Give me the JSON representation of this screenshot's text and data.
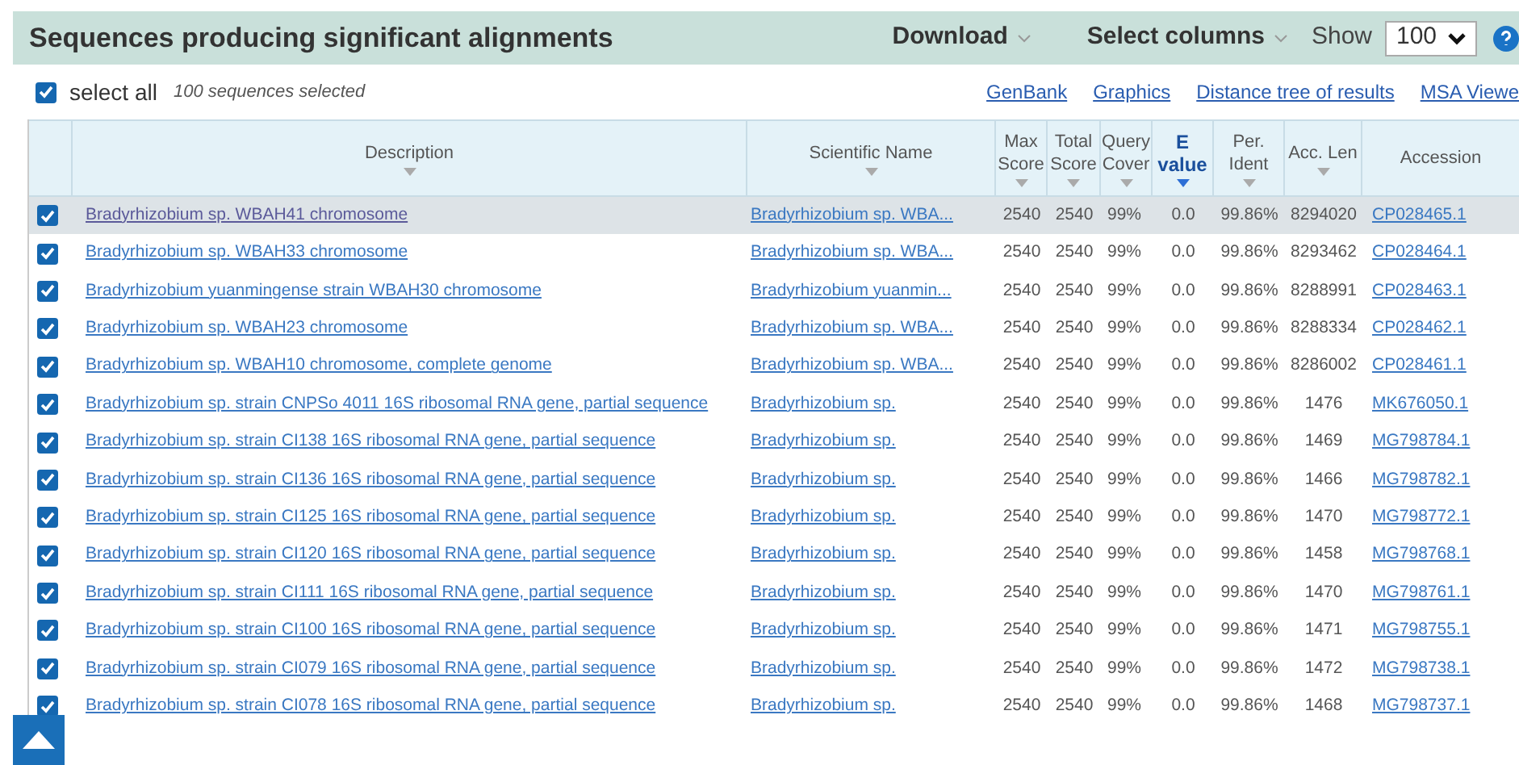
{
  "header": {
    "title": "Sequences producing significant alignments",
    "download": "Download",
    "select_columns": "Select columns",
    "show_label": "Show",
    "show_value": "100"
  },
  "toolbar": {
    "select_all": {
      "label": "select all",
      "checked": true
    },
    "selected_count": "100 sequences selected",
    "links": [
      "GenBank",
      "Graphics",
      "Distance tree of results",
      "MSA Viewe"
    ]
  },
  "table": {
    "columns": [
      {
        "label": "Description",
        "sorted": false
      },
      {
        "label": "Scientific Name",
        "sorted": false
      },
      {
        "label": "Max Score",
        "sorted": false
      },
      {
        "label": "Total Score",
        "sorted": false
      },
      {
        "label": "Query Cover",
        "sorted": false
      },
      {
        "label": "E value",
        "sorted": true
      },
      {
        "label": "Per. Ident",
        "sorted": false
      },
      {
        "label": "Acc. Len",
        "sorted": false
      },
      {
        "label": "Accession",
        "sortable": false
      }
    ],
    "rows": [
      {
        "checked": true,
        "selected": true,
        "cells": [
          "Bradyrhizobium sp. WBAH41 chromosome",
          "Bradyrhizobium sp. WBA...",
          "2540",
          "2540",
          "99%",
          "0.0",
          "99.86%",
          "8294020",
          "CP028465.1"
        ]
      },
      {
        "checked": true,
        "selected": false,
        "cells": [
          "Bradyrhizobium sp. WBAH33 chromosome",
          "Bradyrhizobium sp. WBA...",
          "2540",
          "2540",
          "99%",
          "0.0",
          "99.86%",
          "8293462",
          "CP028464.1"
        ]
      },
      {
        "checked": true,
        "selected": false,
        "cells": [
          "Bradyrhizobium yuanmingense strain WBAH30 chromosome",
          "Bradyrhizobium yuanmin...",
          "2540",
          "2540",
          "99%",
          "0.0",
          "99.86%",
          "8288991",
          "CP028463.1"
        ]
      },
      {
        "checked": true,
        "selected": false,
        "cells": [
          "Bradyrhizobium sp. WBAH23 chromosome",
          "Bradyrhizobium sp. WBA...",
          "2540",
          "2540",
          "99%",
          "0.0",
          "99.86%",
          "8288334",
          "CP028462.1"
        ]
      },
      {
        "checked": true,
        "selected": false,
        "cells": [
          "Bradyrhizobium sp. WBAH10 chromosome, complete genome",
          "Bradyrhizobium sp. WBA...",
          "2540",
          "2540",
          "99%",
          "0.0",
          "99.86%",
          "8286002",
          "CP028461.1"
        ]
      },
      {
        "checked": true,
        "selected": false,
        "cells": [
          "Bradyrhizobium sp. strain CNPSo 4011 16S ribosomal RNA gene, partial sequence",
          "Bradyrhizobium sp.",
          "2540",
          "2540",
          "99%",
          "0.0",
          "99.86%",
          "1476",
          "MK676050.1"
        ]
      },
      {
        "checked": true,
        "selected": false,
        "cells": [
          "Bradyrhizobium sp. strain CI138 16S ribosomal RNA gene, partial sequence",
          "Bradyrhizobium sp.",
          "2540",
          "2540",
          "99%",
          "0.0",
          "99.86%",
          "1469",
          "MG798784.1"
        ]
      },
      {
        "checked": true,
        "selected": false,
        "cells": [
          "Bradyrhizobium sp. strain CI136 16S ribosomal RNA gene, partial sequence",
          "Bradyrhizobium sp.",
          "2540",
          "2540",
          "99%",
          "0.0",
          "99.86%",
          "1466",
          "MG798782.1"
        ]
      },
      {
        "checked": true,
        "selected": false,
        "cells": [
          "Bradyrhizobium sp. strain CI125 16S ribosomal RNA gene, partial sequence",
          "Bradyrhizobium sp.",
          "2540",
          "2540",
          "99%",
          "0.0",
          "99.86%",
          "1470",
          "MG798772.1"
        ]
      },
      {
        "checked": true,
        "selected": false,
        "cells": [
          "Bradyrhizobium sp. strain CI120 16S ribosomal RNA gene, partial sequence",
          "Bradyrhizobium sp.",
          "2540",
          "2540",
          "99%",
          "0.0",
          "99.86%",
          "1458",
          "MG798768.1"
        ]
      },
      {
        "checked": true,
        "selected": false,
        "cells": [
          "Bradyrhizobium sp. strain CI111 16S ribosomal RNA gene, partial sequence",
          "Bradyrhizobium sp.",
          "2540",
          "2540",
          "99%",
          "0.0",
          "99.86%",
          "1470",
          "MG798761.1"
        ]
      },
      {
        "checked": true,
        "selected": false,
        "cells": [
          "Bradyrhizobium sp. strain CI100 16S ribosomal RNA gene, partial sequence",
          "Bradyrhizobium sp.",
          "2540",
          "2540",
          "99%",
          "0.0",
          "99.86%",
          "1471",
          "MG798755.1"
        ]
      },
      {
        "checked": true,
        "selected": false,
        "cells": [
          "Bradyrhizobium sp. strain CI079 16S ribosomal RNA gene, partial sequence",
          "Bradyrhizobium sp.",
          "2540",
          "2540",
          "99%",
          "0.0",
          "99.86%",
          "1472",
          "MG798738.1"
        ]
      },
      {
        "checked": true,
        "selected": false,
        "cells": [
          "Bradyrhizobium sp. strain CI078 16S ribosomal RNA gene, partial sequence",
          "Bradyrhizobium sp.",
          "2540",
          "2540",
          "99%",
          "0.0",
          "99.86%",
          "1468",
          "MG798737.1"
        ]
      }
    ]
  }
}
